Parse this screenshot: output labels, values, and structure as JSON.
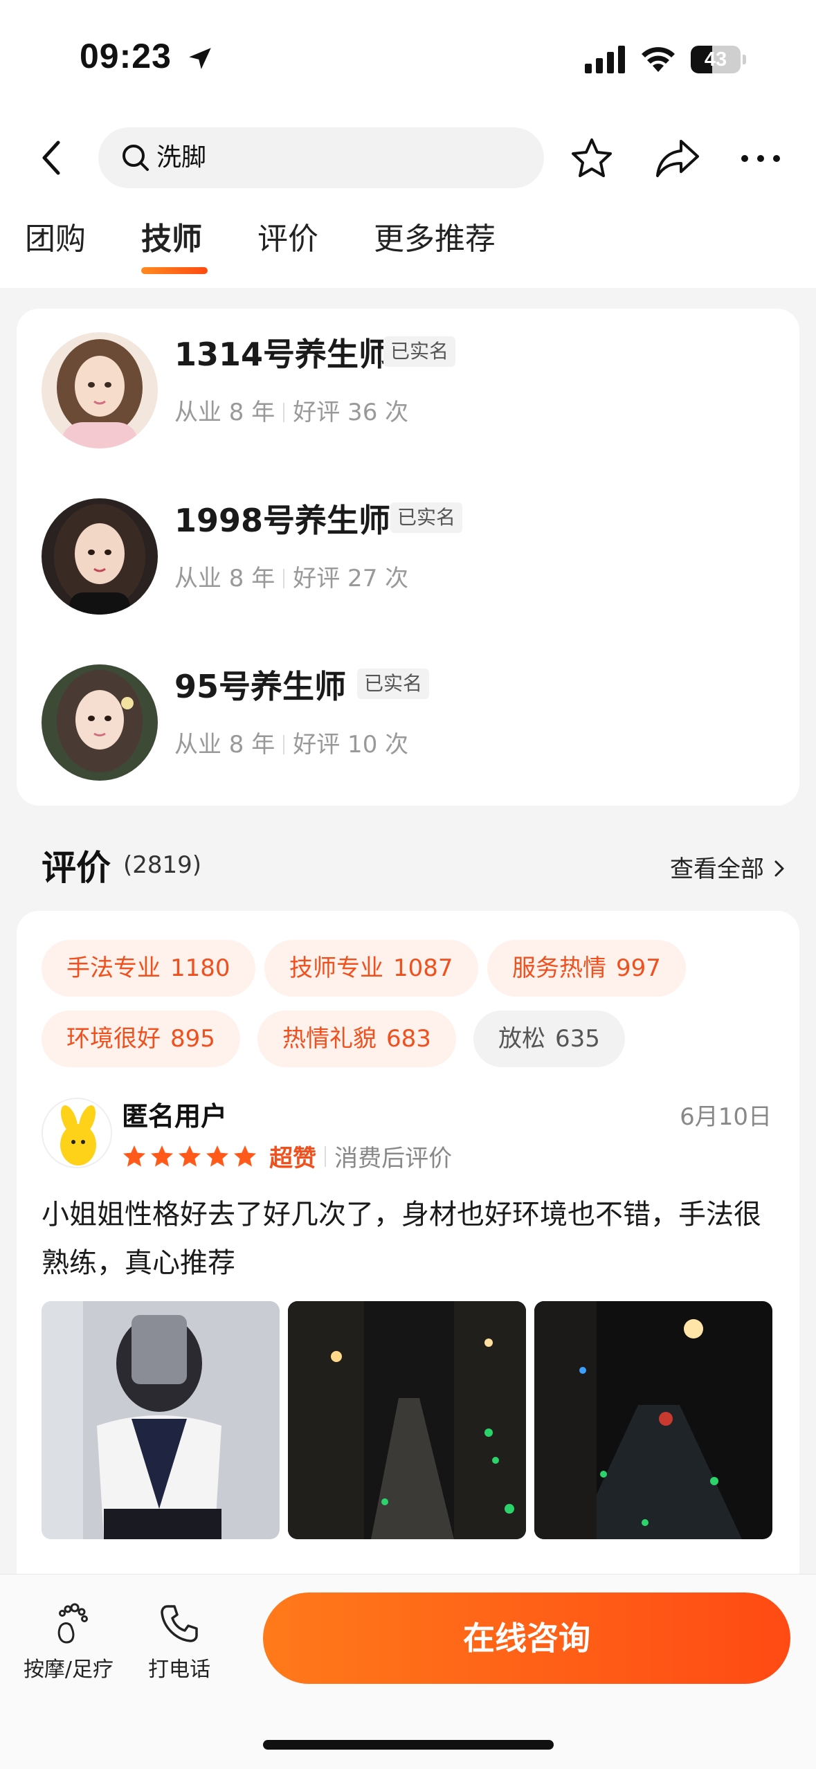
{
  "status_bar": {
    "time": "09:23",
    "battery": "43"
  },
  "search": {
    "query": "洗脚"
  },
  "tabs": [
    {
      "label": "团购"
    },
    {
      "label": "技师"
    },
    {
      "label": "评价"
    },
    {
      "label": "更多推荐"
    }
  ],
  "active_tab": "技师",
  "technicians": [
    {
      "name": "1314号养生师",
      "badge": "已实名",
      "years": "从业 8 年",
      "praise": "好评 36 次"
    },
    {
      "name": "1998号养生师",
      "badge": "已实名",
      "years": "从业 8 年",
      "praise": "好评 27 次"
    },
    {
      "name": "95号养生师",
      "badge": "已实名",
      "years": "从业 8 年",
      "praise": "好评 10 次"
    }
  ],
  "reviews": {
    "title": "评价",
    "count": "(2819)",
    "view_all": "查看全部",
    "tags": [
      {
        "label": "手法专业",
        "count": "1180"
      },
      {
        "label": "技师专业",
        "count": "1087"
      },
      {
        "label": "服务热情",
        "count": "997"
      },
      {
        "label": "环境很好",
        "count": "895"
      },
      {
        "label": "热情礼貌",
        "count": "683"
      },
      {
        "label": "放松",
        "count": "635"
      }
    ],
    "first": {
      "user": "匿名用户",
      "date": "6月10日",
      "stars": 5,
      "rating_label": "超赞",
      "note": "消费后评价",
      "text": "小姐姐性格好去了好几次了，身材也好环境也不错，手法很熟练，真心推荐"
    }
  },
  "bottom_bar": {
    "category_label": "按摩/足疗",
    "call_label": "打电话",
    "consult_label": "在线咨询"
  },
  "colors": {
    "accent": "#ff5a1a",
    "chip_bg": "#fff2ec",
    "page_bg": "#f4f4f4"
  }
}
